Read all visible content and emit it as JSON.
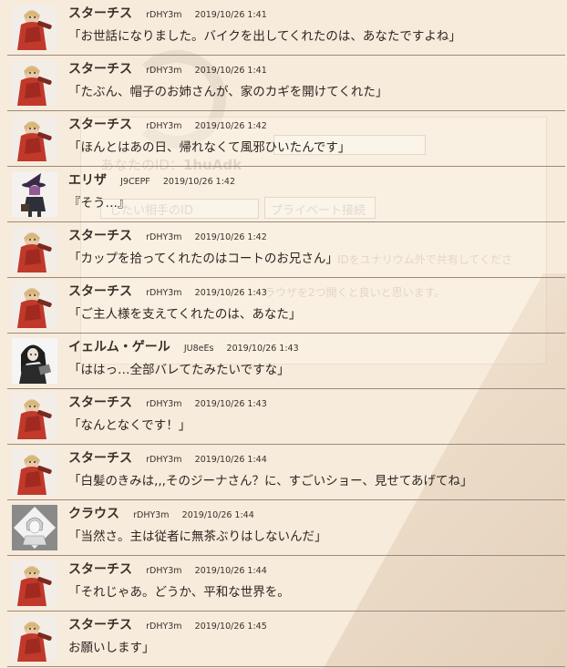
{
  "background": {
    "faded_id_label": "あなたのID：",
    "faded_id_value": "1huAdk",
    "faded_input_placeholder": "したい相手のID",
    "faded_button": "プライベート接続",
    "faded_note_1": "IDをユナリウム外で共有してくださ",
    "faded_note_2": "ラウザを2つ開くと良いと思います。"
  },
  "messages": [
    {
      "avatar": "sarchis-icon",
      "name": "スターチス",
      "uid": "rDHY3m",
      "time": "2019/10/26 1:41",
      "text": "「お世話になりました。バイクを出してくれたのは、あなたですよね」"
    },
    {
      "avatar": "sarchis-icon",
      "name": "スターチス",
      "uid": "rDHY3m",
      "time": "2019/10/26 1:41",
      "text": "「たぶん、帽子のお姉さんが、家のカギを開けてくれた」"
    },
    {
      "avatar": "sarchis-icon",
      "name": "スターチス",
      "uid": "rDHY3m",
      "time": "2019/10/26 1:42",
      "text": "「ほんとはあの日、帰れなくて風邪ひいたんです」"
    },
    {
      "avatar": "witch-icon",
      "name": "エリザ",
      "uid": "J9CEPF",
      "time": "2019/10/26 1:42",
      "text": "『そう…』"
    },
    {
      "avatar": "sarchis-icon",
      "name": "スターチス",
      "uid": "rDHY3m",
      "time": "2019/10/26 1:42",
      "text": "「カップを拾ってくれたのはコートのお兄さん」"
    },
    {
      "avatar": "sarchis-icon",
      "name": "スターチス",
      "uid": "rDHY3m",
      "time": "2019/10/26 1:43",
      "text": "「ご主人様を支えてくれたのは、あなた」"
    },
    {
      "avatar": "dark-haired-icon",
      "name": "イェルム・ゲール",
      "uid": "JU8eEs",
      "time": "2019/10/26 1:43",
      "text": "「ははっ…全部バレてたみたいですな」"
    },
    {
      "avatar": "sarchis-icon",
      "name": "スターチス",
      "uid": "rDHY3m",
      "time": "2019/10/26 1:43",
      "text": "「なんとなくです！」"
    },
    {
      "avatar": "sarchis-icon",
      "name": "スターチス",
      "uid": "rDHY3m",
      "time": "2019/10/26 1:44",
      "text": "「白髪のきみは,,,そのジーナさん？に、すごいショー、見せてあげてね」"
    },
    {
      "avatar": "grey-sketch-icon",
      "name": "クラウス",
      "uid": "rDHY3m",
      "time": "2019/10/26 1:44",
      "text": "「当然さ。主は従者に無茶ぶりはしないんだ」"
    },
    {
      "avatar": "sarchis-icon",
      "name": "スターチス",
      "uid": "rDHY3m",
      "time": "2019/10/26 1:44",
      "text": "「それじゃあ。どうか、平和な世界を。"
    },
    {
      "avatar": "sarchis-icon",
      "name": "スターチス",
      "uid": "rDHY3m",
      "time": "2019/10/26 1:45",
      "text": "お願いします」"
    }
  ]
}
